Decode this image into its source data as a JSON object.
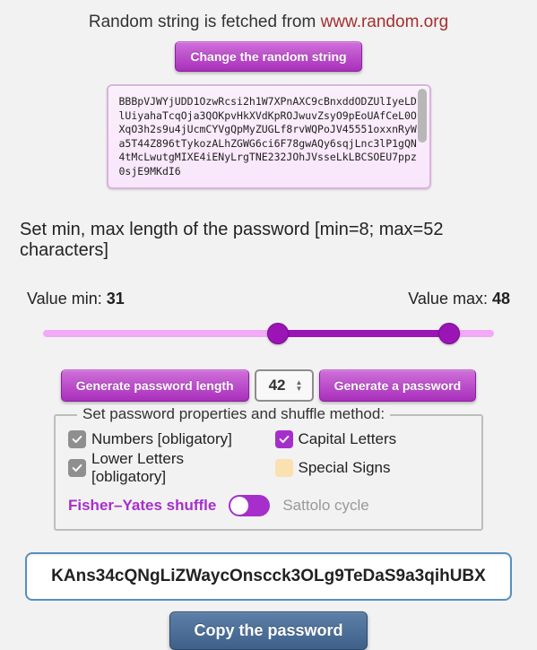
{
  "header": {
    "prefix": "Random string is fetched from ",
    "link": "www.random.org"
  },
  "change_button": "Change the random string",
  "random_string": "BBBpVJWYjUDD1OzwRcsi2h1W7XPnAXC9cBnxddODZUlIyeLDlUiyahaTcqOja3QOKpvHkXVdKpROJwuvZsyO9pEoUAfCeL0OXqO3h2s9u4jUcmCYVgQpMyZUGLf8rvWQPoJV45551oxxnRyWa5T44Z896tTykozALhZGWG6ci6F78gwAQy6sqjLnc3lP1gQN4tMcLwutgMIXE4iENyLrgTNE232JOhJVsseLkLBCSOEU7ppz0sjE9MKdI6",
  "length_label": "Set min, max length of the password [min=8; max=52 characters]",
  "slider": {
    "min_label": "Value min: ",
    "min_value": "31",
    "max_label": "Value max: ",
    "max_value": "48",
    "range_min": 8,
    "range_max": 52,
    "fill_left_pct": 52,
    "fill_width_pct": 38
  },
  "buttons": {
    "gen_length": "Generate password length",
    "gen_password": "Generate a password"
  },
  "num_input": "42",
  "fieldset": {
    "legend": "Set password properties and shuffle method:",
    "numbers": "Numbers [obligatory]",
    "capital": "Capital Letters",
    "lower": "Lower Letters [obligatory]",
    "special": "Special Signs"
  },
  "shuffle": {
    "left": "Fisher–Yates shuffle",
    "right": "Sattolo cycle"
  },
  "password": "KAns34cQNgLiZWaycOnscck3OLg9TeDaS9a3qihUBX",
  "copy_button": "Copy the password"
}
